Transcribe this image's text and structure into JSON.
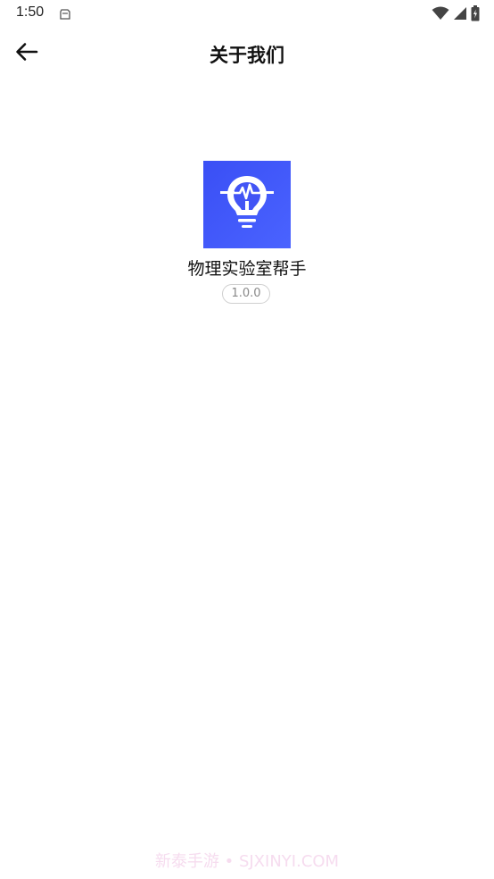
{
  "status_bar": {
    "time": "1:50",
    "icons": [
      "notification-icon",
      "wifi-icon",
      "signal-icon",
      "battery-icon"
    ]
  },
  "header": {
    "title": "关于我们",
    "back_icon": "arrow-left-icon"
  },
  "app": {
    "name": "物理实验室帮手",
    "version": "1.0.0",
    "logo_icon": "lightbulb-pulse-icon"
  },
  "watermark": {
    "text": "新泰手游 • SJXINYI.COM"
  },
  "colors": {
    "logo_background": "#4254f5",
    "watermark": "#f6dcef"
  }
}
